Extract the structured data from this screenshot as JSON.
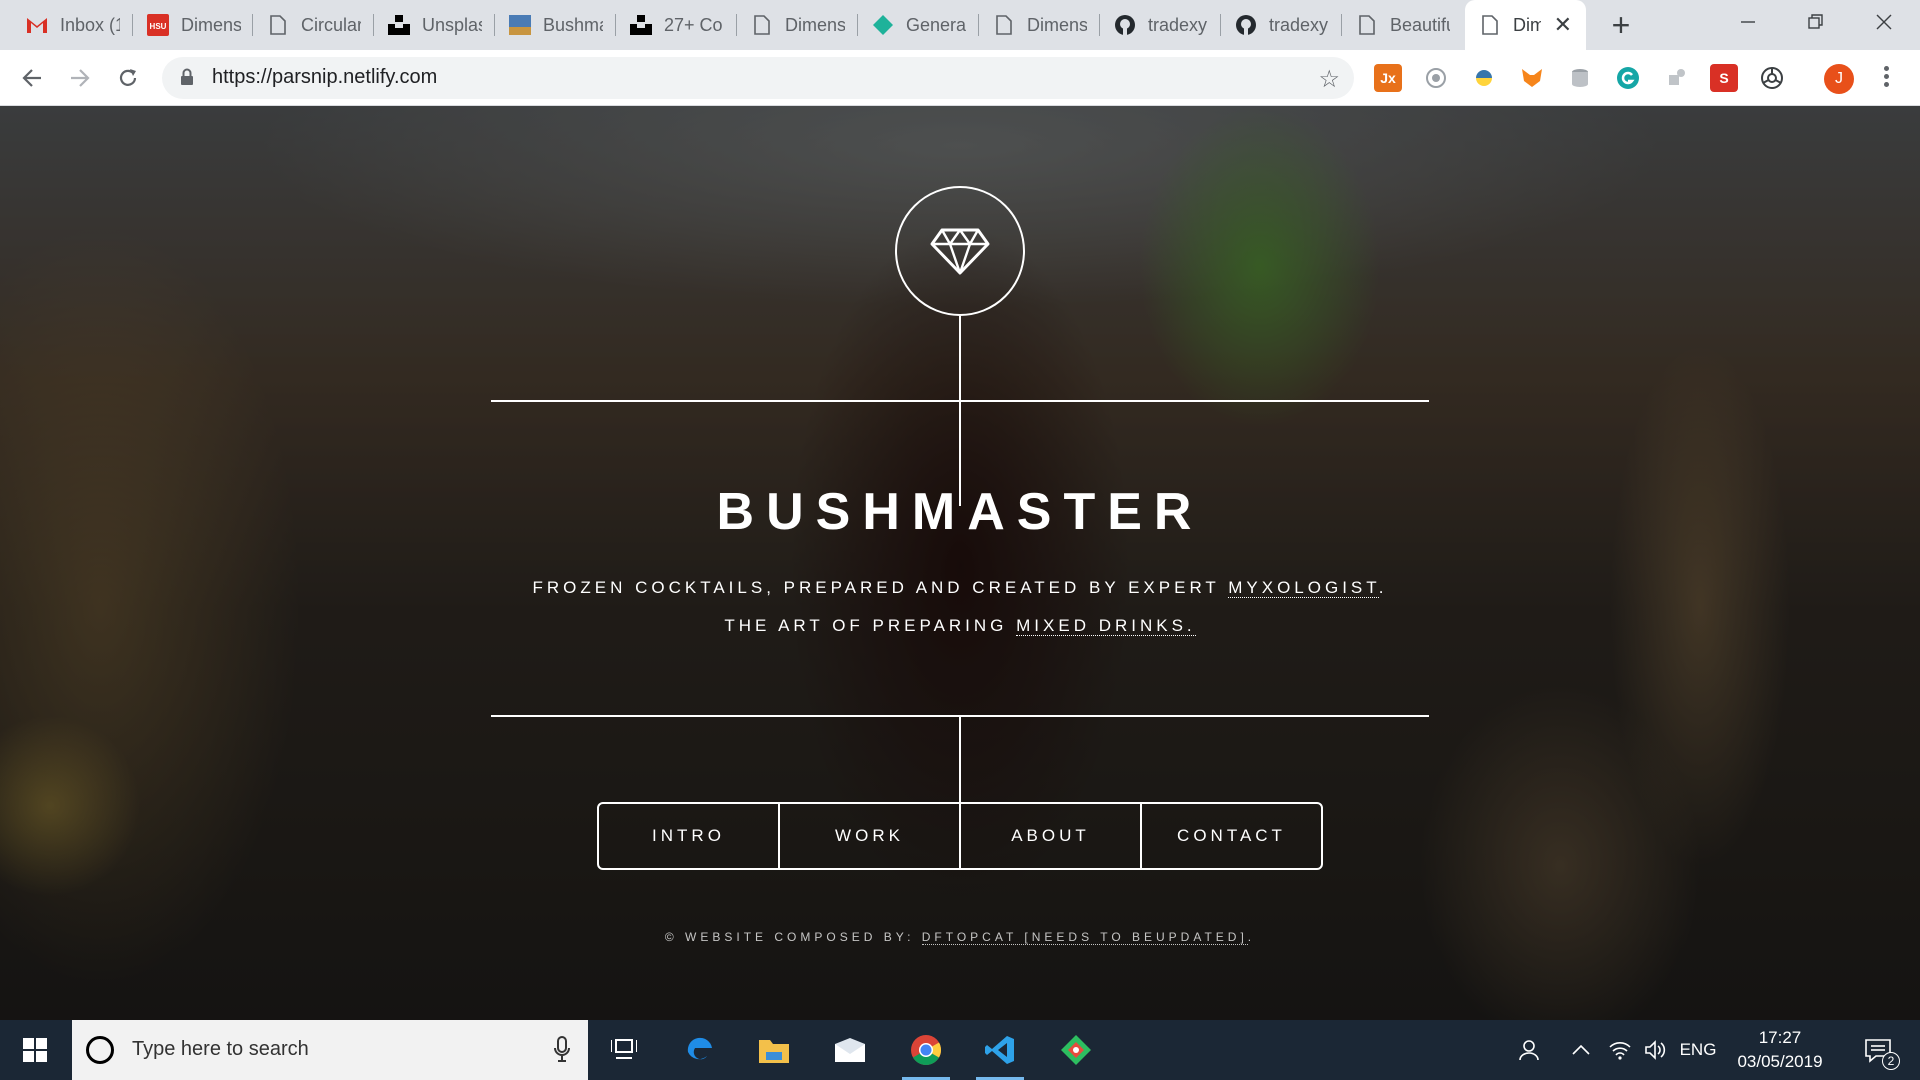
{
  "browser": {
    "tabs": [
      {
        "title": "Inbox (1",
        "icon": "gmail-icon"
      },
      {
        "title": "Dimens",
        "icon": "hsu-icon"
      },
      {
        "title": "Circular",
        "icon": "page-icon"
      },
      {
        "title": "Unsplas",
        "icon": "unsplash-icon"
      },
      {
        "title": "Bushma",
        "icon": "image-icon"
      },
      {
        "title": "27+ Co",
        "icon": "unsplash-icon"
      },
      {
        "title": "Dimens",
        "icon": "page-icon"
      },
      {
        "title": "General",
        "icon": "diamond-icon"
      },
      {
        "title": "Dimens",
        "icon": "page-icon"
      },
      {
        "title": "tradexy",
        "icon": "github-icon"
      },
      {
        "title": "tradexy",
        "icon": "github-icon"
      },
      {
        "title": "Beautifu",
        "icon": "page-icon"
      },
      {
        "title": "Dim",
        "icon": "page-icon",
        "active": true
      }
    ],
    "url": "https://parsnip.netlify.com",
    "profile_initial": "J",
    "extensions": [
      "jx",
      "privacy-badger",
      "python",
      "metamask",
      "database",
      "grammarly",
      "puzzle",
      "s",
      "chromium"
    ]
  },
  "page": {
    "headline": "BUSHMASTER",
    "tagline1_text": "FROZEN COCKTAILS, PREPARED AND CREATED BY EXPERT ",
    "tagline1_link": "MYXOLOGIST",
    "tagline1_end": ".",
    "tagline2_text": "THE ART OF PREPARING ",
    "tagline2_link": "MIXED DRINKS.",
    "nav": [
      "INTRO",
      "WORK",
      "ABOUT",
      "CONTACT"
    ],
    "footer_text": "© WEBSITE COMPOSED BY: ",
    "footer_link": "DFTOPCAT [NEEDS TO BEUPDATED]",
    "footer_end": "."
  },
  "taskbar": {
    "search_placeholder": "Type here to search",
    "language": "ENG",
    "time": "17:27",
    "date": "03/05/2019",
    "notifications": "2"
  },
  "colors": {
    "tabstrip": "#dee1e6",
    "taskbar": "#1b2735",
    "avatar": "#e8501a"
  }
}
